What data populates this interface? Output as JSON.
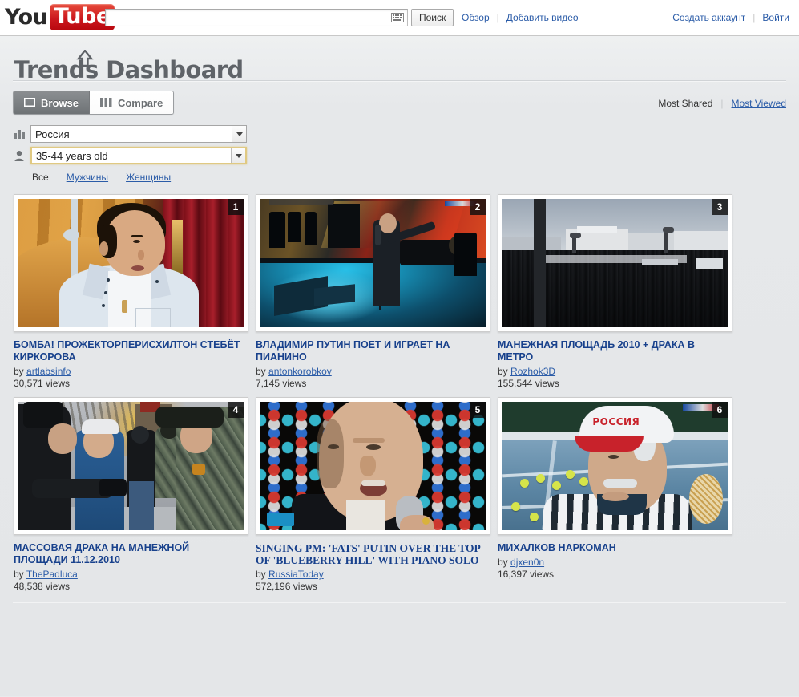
{
  "masthead": {
    "logo": {
      "you": "You",
      "tube": "Tube"
    },
    "search": {
      "value": "",
      "placeholder": "",
      "button_label": "Поиск",
      "keyboard_icon": "keyboard-icon"
    },
    "links_left": [
      {
        "label": "Обзор",
        "name": "browse-link"
      },
      {
        "label": "Добавить видео",
        "name": "upload-link"
      }
    ],
    "links_right": [
      {
        "label": "Создать аккаунт",
        "name": "create-account-link"
      },
      {
        "label": "Войти",
        "name": "sign-in-link"
      }
    ]
  },
  "page": {
    "title": "Trends Dashboard",
    "title_arrow_icon": "arrow-up-icon"
  },
  "tabs": [
    {
      "label": "Browse",
      "icon": "rectangle-icon",
      "active": true
    },
    {
      "label": "Compare",
      "icon": "bars-icon",
      "active": false
    }
  ],
  "sort": {
    "active_label": "Most Shared",
    "link_label": "Most Viewed"
  },
  "filters": {
    "region": {
      "icon": "bar-chart-icon",
      "value": "Россия",
      "focused": false
    },
    "age": {
      "icon": "person-icon",
      "value": "35-44 years old",
      "focused": true
    },
    "gender": {
      "active": "Все",
      "options": [
        "Мужчины",
        "Женщины"
      ]
    }
  },
  "videos": [
    {
      "rank": "1",
      "title": "Бомба! Прожекторперисхилтон стебёт Киркорова",
      "by_prefix": "by",
      "author": "artlabsinfo",
      "views": "30,571 views",
      "serif": false
    },
    {
      "rank": "2",
      "title": "Владимир Путин поет и играет на пианино",
      "by_prefix": "by",
      "author": "antonkorobkov",
      "views": "7,145 views",
      "serif": false
    },
    {
      "rank": "3",
      "title": "Манежная площадь 2010 + драка в метро",
      "by_prefix": "by",
      "author": "Rozhok3D",
      "views": "155,544 views",
      "serif": false
    },
    {
      "rank": "4",
      "title": "Массовая драка на Манежной площади 11.12.2010",
      "by_prefix": "by",
      "author": "ThePadluca",
      "views": "48,538 views",
      "serif": false
    },
    {
      "rank": "5",
      "title": "Singing PM: 'Fats' Putin over the top of 'Blueberry Hill' with piano solo",
      "by_prefix": "by",
      "author": "RussiaToday",
      "views": "572,196 views",
      "serif": true
    },
    {
      "rank": "6",
      "title": "Михалков наркоман",
      "by_prefix": "by",
      "author": "djxen0n",
      "views": "16,397 views",
      "serif": false
    }
  ],
  "thumb_badges": {
    "cap_text": "РОССИЯ"
  },
  "colors": {
    "brand_red": "#cc181e",
    "link_blue": "#2b5ca8",
    "title_blue": "#18418c",
    "page_bg": "#e8eaec",
    "focus_gold": "#e0c982"
  }
}
